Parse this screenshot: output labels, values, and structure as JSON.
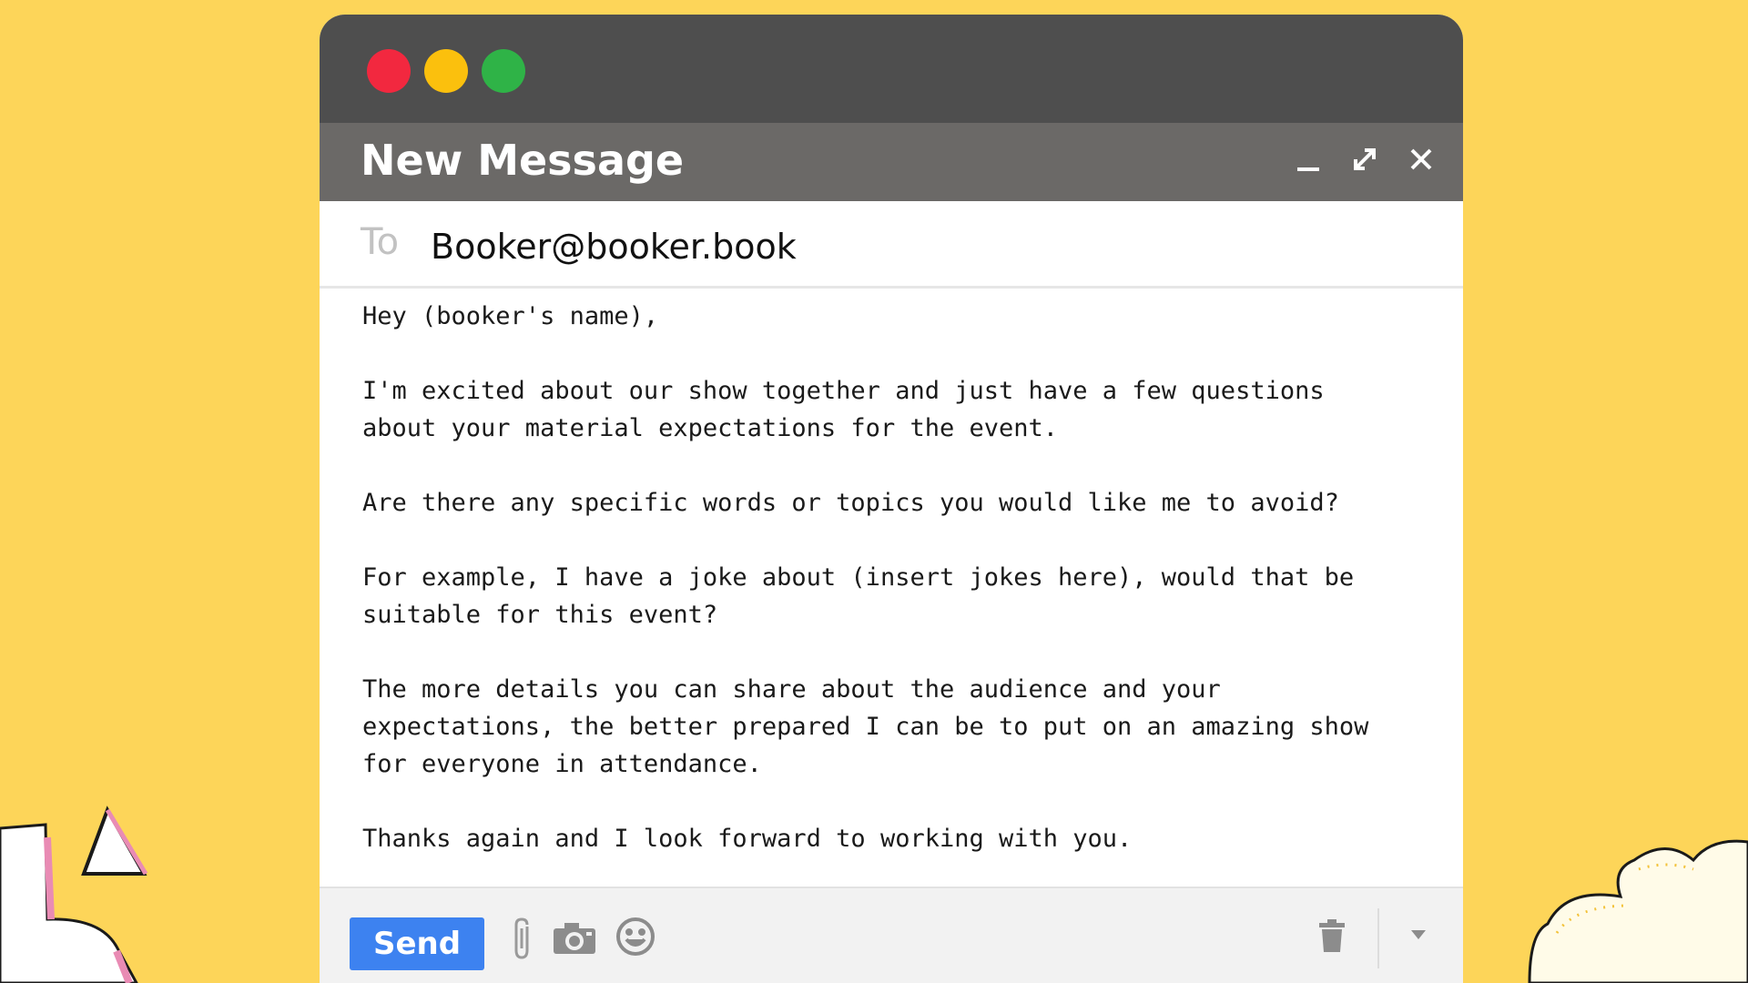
{
  "window": {
    "title": "New Message"
  },
  "recipient": {
    "label": "To",
    "value": "Booker@booker.book"
  },
  "message": {
    "paragraphs": [
      "Hey (booker's name),",
      "I'm excited about our show together and just have a few questions about your material expectations for the event.",
      "Are there any specific words or topics you would like me to avoid?",
      "For example, I have a joke about (insert jokes here), would that be suitable for this event?",
      "The more details you can share about the audience and your expectations, the better prepared I can be to put on an amazing show for everyone in attendance.",
      "Thanks again and I look forward to working with you."
    ]
  },
  "footer": {
    "send_label": "Send",
    "icons": [
      "paperclip-icon",
      "camera-icon",
      "emoji-icon",
      "trash-icon",
      "chevron-down-icon"
    ]
  },
  "colors": {
    "background": "#fdd559",
    "titlebar": "#4e4e4e",
    "header": "#6b6967",
    "send": "#3d82f0",
    "close_dot": "#f2283f",
    "minimize_dot": "#fbc00d",
    "maximize_dot": "#2fb347"
  }
}
